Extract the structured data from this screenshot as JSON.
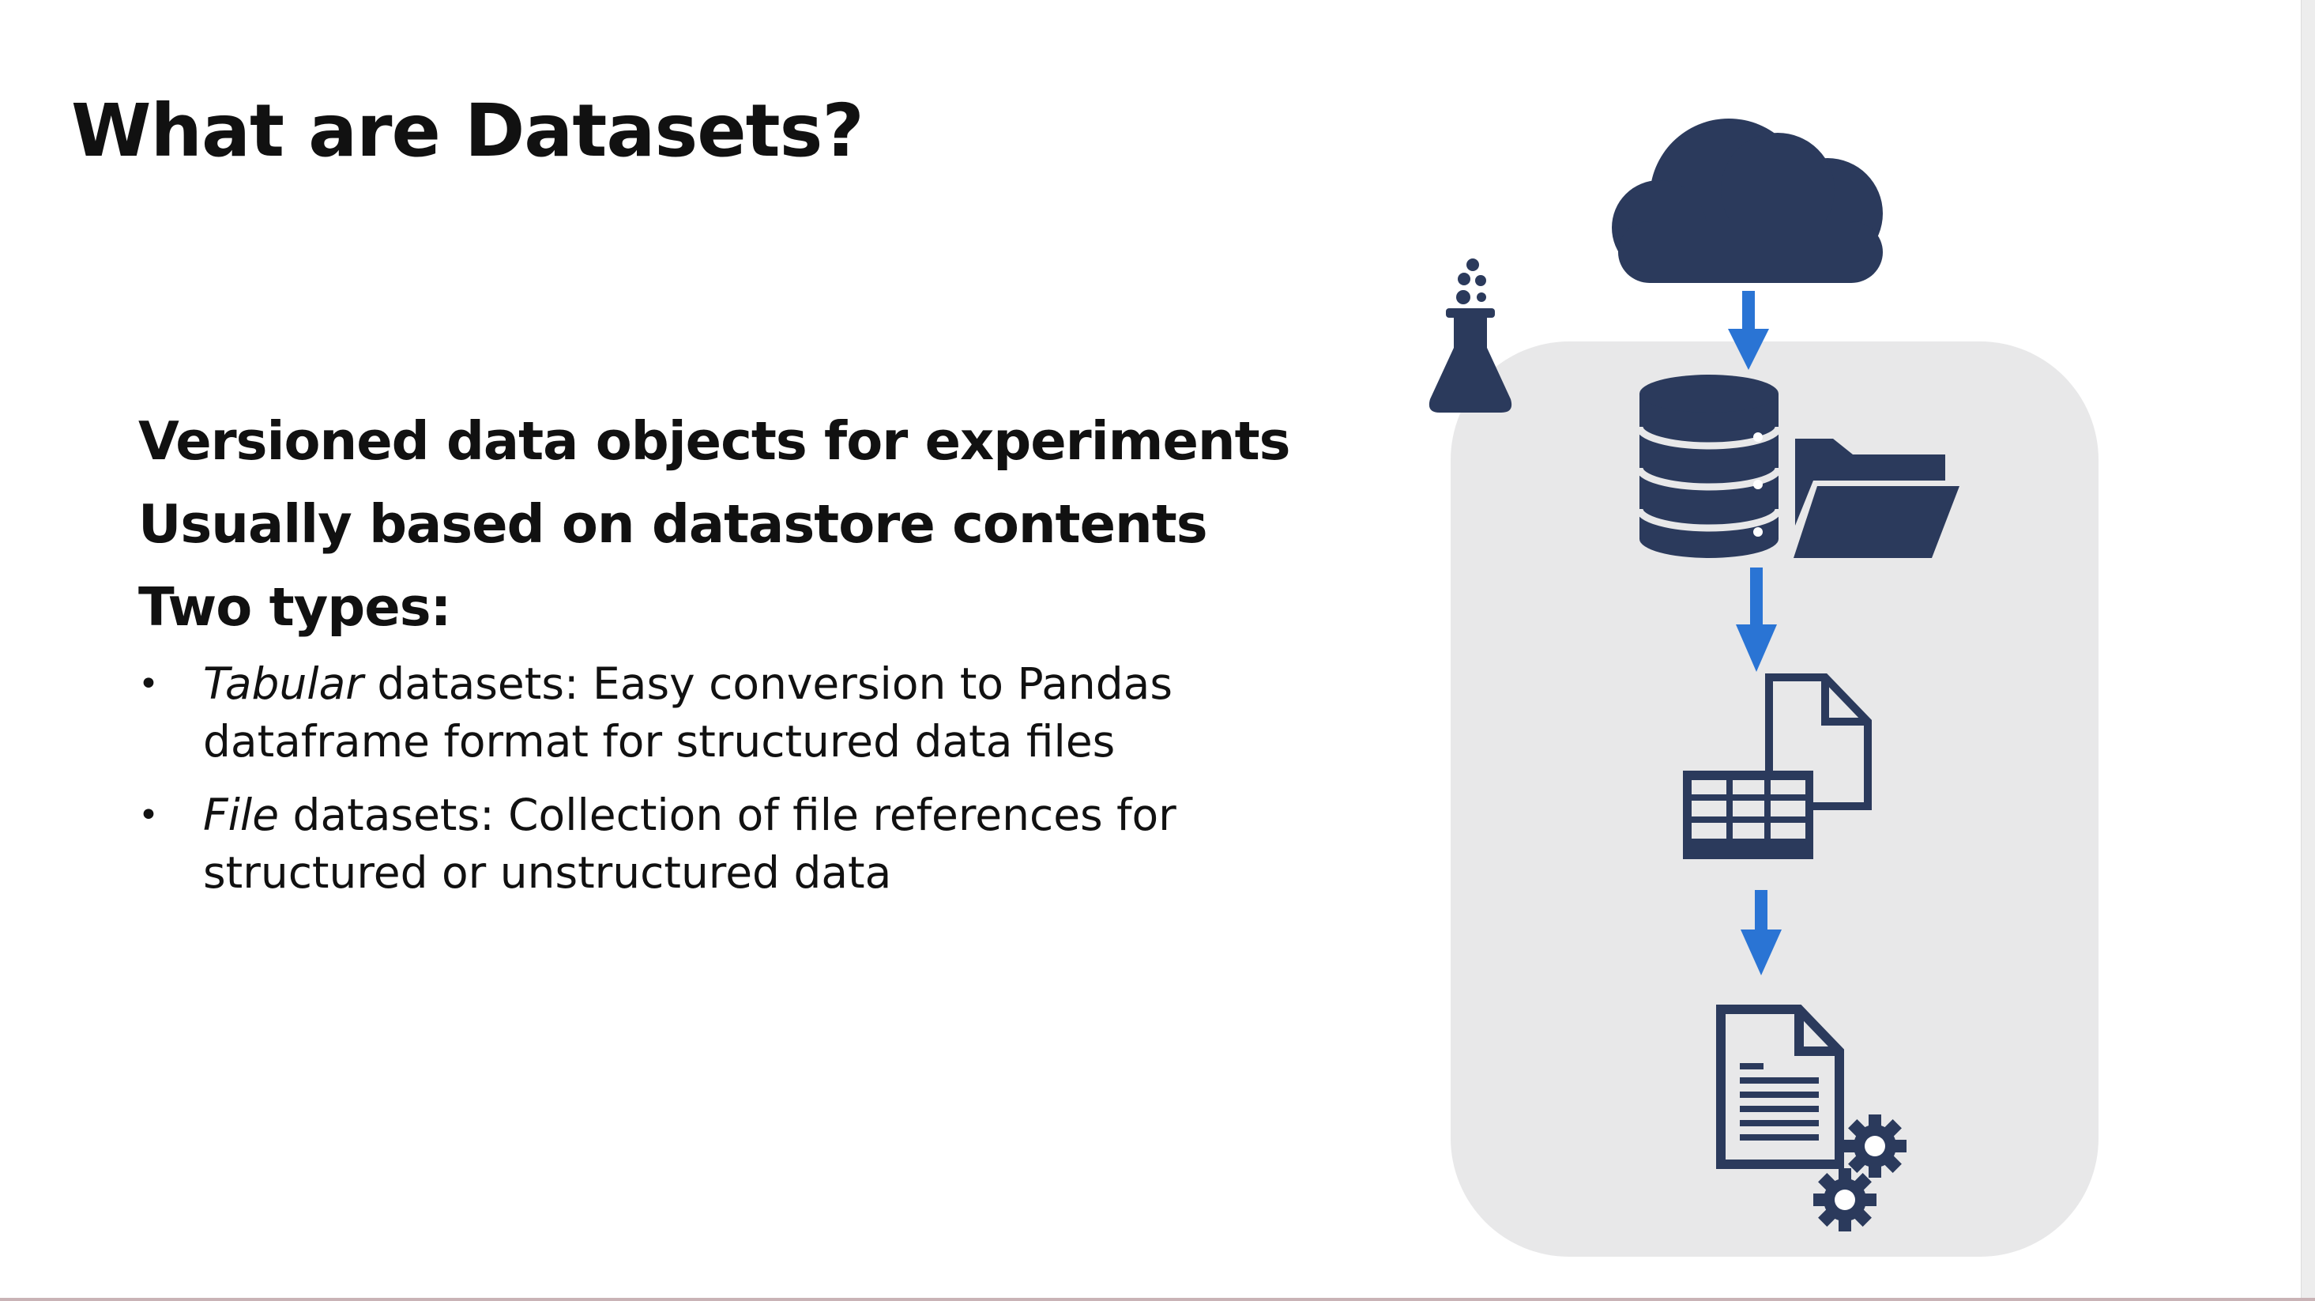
{
  "slide": {
    "title": "What are Datasets?",
    "points": [
      "Versioned data objects for experiments",
      "Usually based on datastore contents",
      "Two types:"
    ],
    "sub_points": [
      {
        "emphasis": "Tabular",
        "text_line1": " datasets: Easy conversion to Pandas",
        "text_line2": "dataframe format for structured data files"
      },
      {
        "emphasis": "File",
        "text_line1": " datasets: Collection of file references for",
        "text_line2": "structured or unstructured data"
      }
    ],
    "bullet_symbol": "•"
  },
  "diagram": {
    "icons": [
      "cloud-icon",
      "flask-icon",
      "database-icon",
      "folder-icon",
      "table-icon",
      "document-icon",
      "gear-icon"
    ],
    "colors": {
      "icon": "#2b3a5c",
      "arrow": "#2a74d4",
      "panel": "#e8e8e9"
    }
  }
}
